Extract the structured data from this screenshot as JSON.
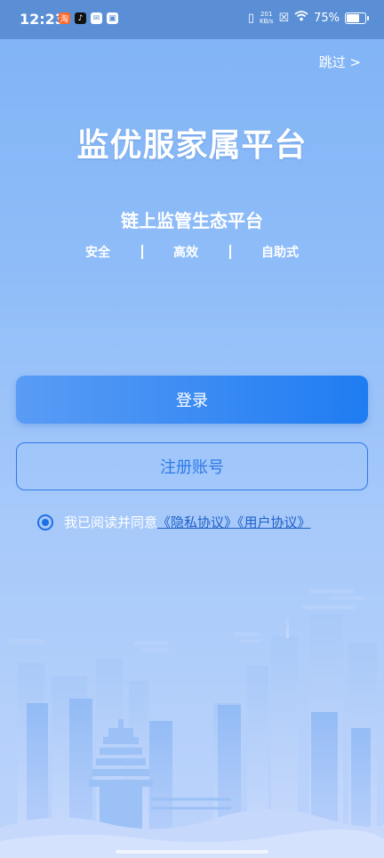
{
  "status_bar": {
    "time": "12:23",
    "net_speed_value": "201",
    "net_speed_unit": "KB/s",
    "battery": "75%",
    "battery_level": 0.75
  },
  "skip_label": "跳过 >",
  "app_title": "监优服家属平台",
  "subtitle": "链上监管生态平台",
  "features": [
    "安全",
    "高效",
    "自助式"
  ],
  "login_label": "登录",
  "register_label": "注册账号",
  "agreement": {
    "prefix": "我已阅读并同意",
    "privacy_link": "《隐私协议》",
    "user_link": "《用户协议》"
  },
  "colors": {
    "primary": "#1f7cf2",
    "status_bar": "#5a8fd6"
  }
}
